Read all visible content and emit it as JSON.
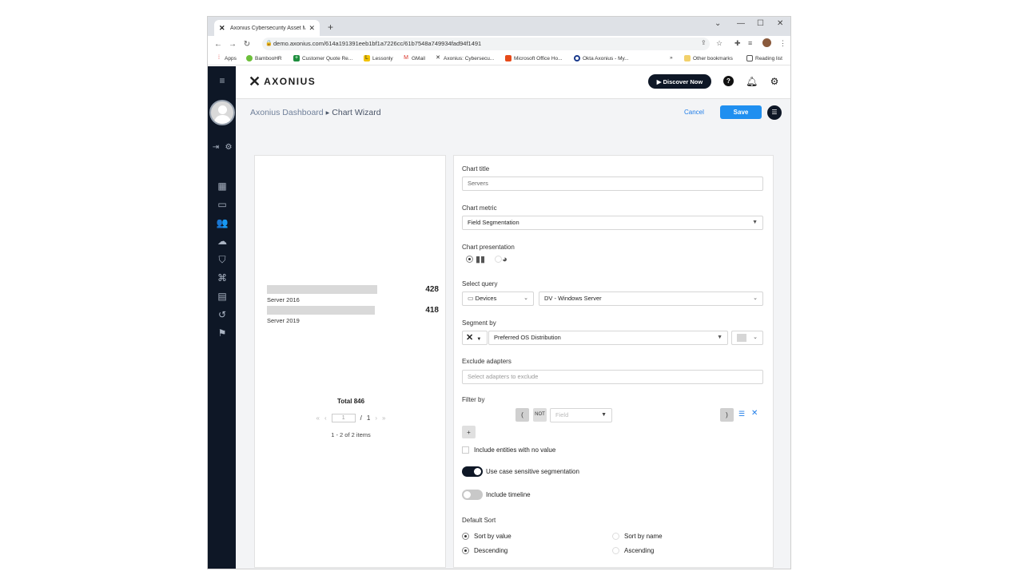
{
  "browser": {
    "tab_title": "Axonius Cybersecurity Asset Ma",
    "url": "demo.axonius.com/614a191391eeb1bf1a7226cc/61b7548a749934fad94f1491",
    "bookmarks": [
      "Apps",
      "BambooHR",
      "Customer Quote Re...",
      "Lessonly",
      "GMail",
      "Axonius: Cybersecu...",
      "Microsoft Office Ho...",
      "Okta Axonius - My..."
    ],
    "other_bookmarks": "Other bookmarks",
    "reading_list": "Reading list"
  },
  "header": {
    "logo_text": "AXONIUS",
    "discover_label": "▶ Discover Now"
  },
  "breadcrumb": {
    "parent": "Axonius Dashboard",
    "current": "Chart Wizard"
  },
  "actions": {
    "cancel_label": "Cancel",
    "save_label": "Save"
  },
  "preview": {
    "total_label": "Total 846",
    "page_input": "1",
    "page_sep": "/",
    "page_total": "1",
    "items_label": "1 - 2 of 2 items"
  },
  "chart_data": {
    "type": "bar",
    "orientation": "horizontal",
    "categories": [
      "Server 2016",
      "Server 2019"
    ],
    "values": [
      428,
      418
    ],
    "total": 846,
    "colors": [
      "#d9d9d9",
      "#d9d9d9"
    ]
  },
  "form": {
    "chart_title_label": "Chart title",
    "chart_title_value": "Servers",
    "chart_metric_label": "Chart metric",
    "chart_metric_value": "Field Segmentation",
    "chart_presentation_label": "Chart presentation",
    "select_query_label": "Select query",
    "entity_value": "Devices",
    "query_value": "DV - Windows Server",
    "segment_by_label": "Segment by",
    "segment_field_value": "Preferred OS Distribution",
    "exclude_adapters_label": "Exclude adapters",
    "exclude_adapters_placeholder": "Select adapters to exclude",
    "filter_by_label": "Filter by",
    "filter_open_paren": "(",
    "filter_not": "NOT",
    "filter_field_placeholder": "Field",
    "filter_close_paren": ")",
    "add_filter_label": "+",
    "include_no_value_label": "Include entities with no value",
    "case_sensitive_label": "Use case sensitive segmentation",
    "include_timeline_label": "Include timeline",
    "default_sort_label": "Default Sort",
    "sort_by_value_label": "Sort by value",
    "sort_by_name_label": "Sort by name",
    "descending_label": "Descending",
    "ascending_label": "Ascending"
  }
}
